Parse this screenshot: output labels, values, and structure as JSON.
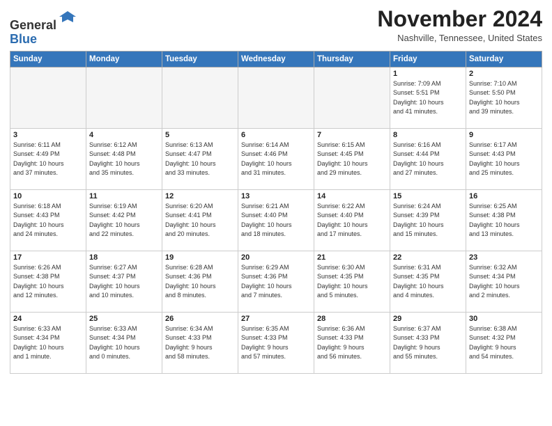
{
  "header": {
    "logo_line1": "General",
    "logo_line2": "Blue",
    "month_title": "November 2024",
    "subtitle": "Nashville, Tennessee, United States"
  },
  "weekdays": [
    "Sunday",
    "Monday",
    "Tuesday",
    "Wednesday",
    "Thursday",
    "Friday",
    "Saturday"
  ],
  "weeks": [
    [
      {
        "day": "",
        "info": ""
      },
      {
        "day": "",
        "info": ""
      },
      {
        "day": "",
        "info": ""
      },
      {
        "day": "",
        "info": ""
      },
      {
        "day": "",
        "info": ""
      },
      {
        "day": "1",
        "info": "Sunrise: 7:09 AM\nSunset: 5:51 PM\nDaylight: 10 hours\nand 41 minutes."
      },
      {
        "day": "2",
        "info": "Sunrise: 7:10 AM\nSunset: 5:50 PM\nDaylight: 10 hours\nand 39 minutes."
      }
    ],
    [
      {
        "day": "3",
        "info": "Sunrise: 6:11 AM\nSunset: 4:49 PM\nDaylight: 10 hours\nand 37 minutes."
      },
      {
        "day": "4",
        "info": "Sunrise: 6:12 AM\nSunset: 4:48 PM\nDaylight: 10 hours\nand 35 minutes."
      },
      {
        "day": "5",
        "info": "Sunrise: 6:13 AM\nSunset: 4:47 PM\nDaylight: 10 hours\nand 33 minutes."
      },
      {
        "day": "6",
        "info": "Sunrise: 6:14 AM\nSunset: 4:46 PM\nDaylight: 10 hours\nand 31 minutes."
      },
      {
        "day": "7",
        "info": "Sunrise: 6:15 AM\nSunset: 4:45 PM\nDaylight: 10 hours\nand 29 minutes."
      },
      {
        "day": "8",
        "info": "Sunrise: 6:16 AM\nSunset: 4:44 PM\nDaylight: 10 hours\nand 27 minutes."
      },
      {
        "day": "9",
        "info": "Sunrise: 6:17 AM\nSunset: 4:43 PM\nDaylight: 10 hours\nand 25 minutes."
      }
    ],
    [
      {
        "day": "10",
        "info": "Sunrise: 6:18 AM\nSunset: 4:43 PM\nDaylight: 10 hours\nand 24 minutes."
      },
      {
        "day": "11",
        "info": "Sunrise: 6:19 AM\nSunset: 4:42 PM\nDaylight: 10 hours\nand 22 minutes."
      },
      {
        "day": "12",
        "info": "Sunrise: 6:20 AM\nSunset: 4:41 PM\nDaylight: 10 hours\nand 20 minutes."
      },
      {
        "day": "13",
        "info": "Sunrise: 6:21 AM\nSunset: 4:40 PM\nDaylight: 10 hours\nand 18 minutes."
      },
      {
        "day": "14",
        "info": "Sunrise: 6:22 AM\nSunset: 4:40 PM\nDaylight: 10 hours\nand 17 minutes."
      },
      {
        "day": "15",
        "info": "Sunrise: 6:24 AM\nSunset: 4:39 PM\nDaylight: 10 hours\nand 15 minutes."
      },
      {
        "day": "16",
        "info": "Sunrise: 6:25 AM\nSunset: 4:38 PM\nDaylight: 10 hours\nand 13 minutes."
      }
    ],
    [
      {
        "day": "17",
        "info": "Sunrise: 6:26 AM\nSunset: 4:38 PM\nDaylight: 10 hours\nand 12 minutes."
      },
      {
        "day": "18",
        "info": "Sunrise: 6:27 AM\nSunset: 4:37 PM\nDaylight: 10 hours\nand 10 minutes."
      },
      {
        "day": "19",
        "info": "Sunrise: 6:28 AM\nSunset: 4:36 PM\nDaylight: 10 hours\nand 8 minutes."
      },
      {
        "day": "20",
        "info": "Sunrise: 6:29 AM\nSunset: 4:36 PM\nDaylight: 10 hours\nand 7 minutes."
      },
      {
        "day": "21",
        "info": "Sunrise: 6:30 AM\nSunset: 4:35 PM\nDaylight: 10 hours\nand 5 minutes."
      },
      {
        "day": "22",
        "info": "Sunrise: 6:31 AM\nSunset: 4:35 PM\nDaylight: 10 hours\nand 4 minutes."
      },
      {
        "day": "23",
        "info": "Sunrise: 6:32 AM\nSunset: 4:34 PM\nDaylight: 10 hours\nand 2 minutes."
      }
    ],
    [
      {
        "day": "24",
        "info": "Sunrise: 6:33 AM\nSunset: 4:34 PM\nDaylight: 10 hours\nand 1 minute."
      },
      {
        "day": "25",
        "info": "Sunrise: 6:33 AM\nSunset: 4:34 PM\nDaylight: 10 hours\nand 0 minutes."
      },
      {
        "day": "26",
        "info": "Sunrise: 6:34 AM\nSunset: 4:33 PM\nDaylight: 9 hours\nand 58 minutes."
      },
      {
        "day": "27",
        "info": "Sunrise: 6:35 AM\nSunset: 4:33 PM\nDaylight: 9 hours\nand 57 minutes."
      },
      {
        "day": "28",
        "info": "Sunrise: 6:36 AM\nSunset: 4:33 PM\nDaylight: 9 hours\nand 56 minutes."
      },
      {
        "day": "29",
        "info": "Sunrise: 6:37 AM\nSunset: 4:33 PM\nDaylight: 9 hours\nand 55 minutes."
      },
      {
        "day": "30",
        "info": "Sunrise: 6:38 AM\nSunset: 4:32 PM\nDaylight: 9 hours\nand 54 minutes."
      }
    ]
  ]
}
